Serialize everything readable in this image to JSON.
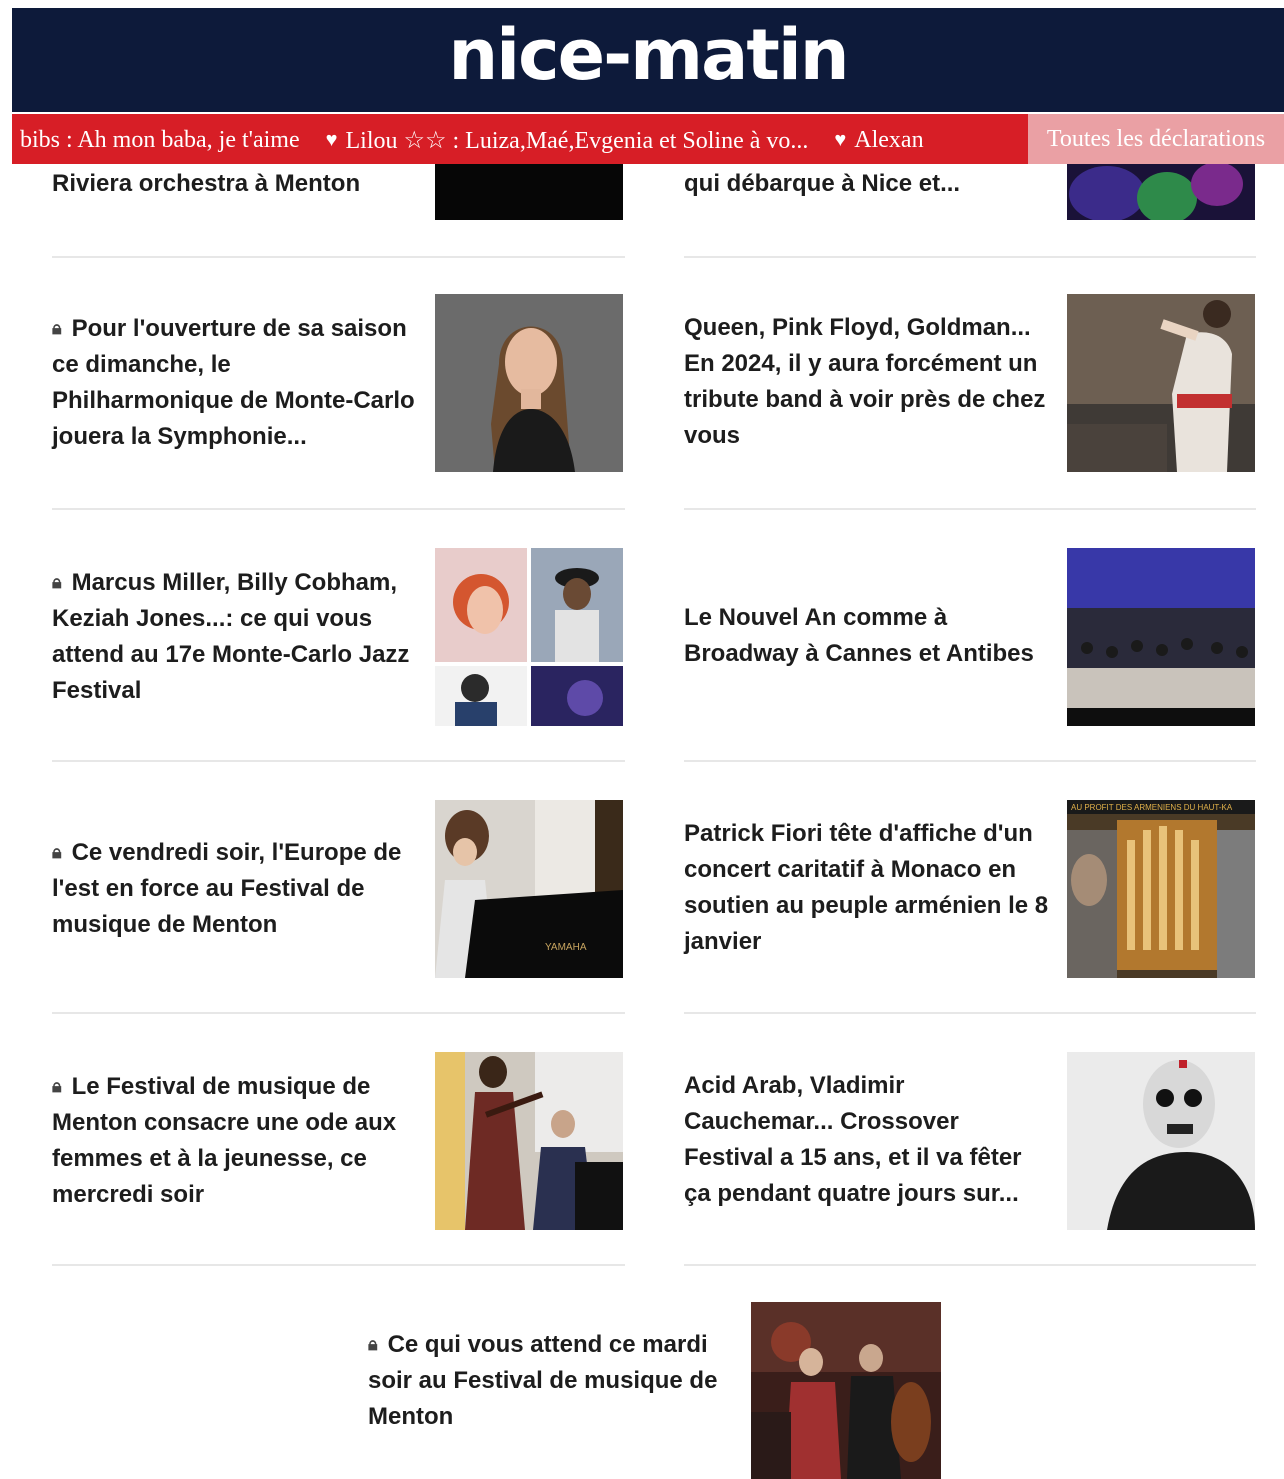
{
  "header": {
    "logo": "nice-matin"
  },
  "ticker": {
    "items": [
      {
        "text": "bibs : Ah mon baba, je t'aime",
        "heart": false
      },
      {
        "text": "Lilou ☆☆ : Luiza,Maé,Evgenia et Soline à vo...",
        "heart": true
      },
      {
        "text": "Alexan",
        "heart": true
      }
    ],
    "cta": "Toutes les déclarations"
  },
  "partial": {
    "left_title": "Riviera orchestra à Menton",
    "right_title": "qui débarque à Nice et..."
  },
  "articles": [
    {
      "title": "Pour l'ouverture de sa saison ce dimanche, le Philharmonique de Monte-Carlo jouera la Symphonie...",
      "locked": true
    },
    {
      "title": "Queen, Pink Floyd, Goldman... En 2024, il y aura forcément un tribute band à voir près de chez vous",
      "locked": false
    },
    {
      "title": "Marcus Miller, Billy Cobham, Keziah Jones...: ce qui vous attend au 17e Monte-Carlo Jazz Festival",
      "locked": true
    },
    {
      "title": "Le Nouvel An comme à Broadway à Cannes et Antibes",
      "locked": false
    },
    {
      "title": "Ce vendredi soir, l'Europe de l'est en force au Festival de musique de Menton",
      "locked": true
    },
    {
      "title": "Patrick Fiori tête d'affiche d'un concert caritatif à Monaco en soutien au peuple arménien le 8 janvier",
      "locked": false
    },
    {
      "title": "Le Festival de musique de Menton consacre une ode aux femmes et à la jeunesse, ce mercredi soir",
      "locked": true
    },
    {
      "title": "Acid Arab, Vladimir Cauchemar... Crossover Festival a 15 ans, et il va fêter ça pendant quatre jours sur...",
      "locked": false
    },
    {
      "title": "Ce qui vous attend ce mardi soir au Festival de musique de Menton",
      "locked": true
    }
  ],
  "image_banner_text": "AU PROFIT DES ARMENIENS DU HAUT-KA",
  "piano_brand": "YAMAHA"
}
